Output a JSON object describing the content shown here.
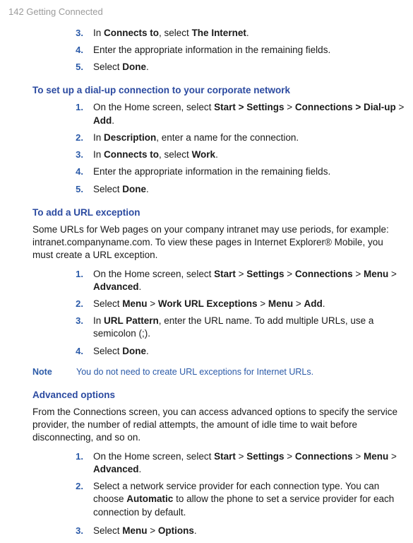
{
  "header": "142  Getting Connected",
  "topSteps": [
    {
      "num": "3.",
      "plain1": "In ",
      "bold1": "Connects to",
      "plain2": ", select ",
      "bold2": "The Internet",
      "plain3": "."
    },
    {
      "num": "4.",
      "plain1": "Enter the appropriate information in the remaining fields."
    },
    {
      "num": "5.",
      "plain1": "Select ",
      "bold1": "Done",
      "plain2": "."
    }
  ],
  "sec1": {
    "heading": "To set up a dial-up connection to your corporate network",
    "steps": [
      {
        "num": "1.",
        "plain1": "On the Home screen, select ",
        "bold1": "Start > ",
        "bold2": "Settings",
        "plain2": " > ",
        "bold3": "Connections > Dial-up",
        "plain3": " > ",
        "bold4": "Add",
        "plain4": "."
      },
      {
        "num": "2.",
        "plain1": "In ",
        "bold1": "Description",
        "plain2": ", enter a name for the connection."
      },
      {
        "num": "3.",
        "plain1": "In ",
        "bold1": "Connects to",
        "plain2": ", select ",
        "bold2": "Work",
        "plain3": "."
      },
      {
        "num": "4.",
        "plain1": "Enter the appropriate information in the remaining fields."
      },
      {
        "num": "5.",
        "plain1": "Select ",
        "bold1": "Done",
        "plain2": "."
      }
    ]
  },
  "sec2": {
    "heading": "To add a URL exception",
    "intro": "Some URLs for Web pages on your company intranet may use periods, for example: intranet.companyname.com. To view these pages in Internet Explorer® Mobile, you must create a URL exception.",
    "steps": [
      {
        "num": "1.",
        "plain1": "On the Home screen, select ",
        "bold1": "Start",
        "plain2": " > ",
        "bold2": "Settings",
        "plain3": " > ",
        "bold3": "Connections",
        "plain4": " > ",
        "bold4": "Menu",
        "plain5": " > ",
        "bold5": "Advanced",
        "plain6": "."
      },
      {
        "num": "2.",
        "plain1": "Select ",
        "bold1": "Menu",
        "plain2": " > ",
        "bold2": "Work URL Exceptions",
        "plain3": " > ",
        "bold3": "Menu",
        "plain4": " > ",
        "bold4": "Add",
        "plain5": "."
      },
      {
        "num": "3.",
        "plain1": "In ",
        "bold1": "URL Pattern",
        "plain2": ", enter the URL name. To add multiple URLs, use a semicolon (;)."
      },
      {
        "num": "4.",
        "plain1": "Select ",
        "bold1": "Done",
        "plain2": "."
      }
    ],
    "noteLabel": "Note",
    "noteBody": "You do not need to create URL exceptions for Internet URLs."
  },
  "sec3": {
    "heading": "Advanced options",
    "intro": "From the Connections screen, you can access advanced options to specify the service provider, the number of redial attempts, the amount of idle time to wait before disconnecting, and so on.",
    "steps": [
      {
        "num": "1.",
        "plain1": "On the Home screen, select ",
        "bold1": "Start",
        "plain2": " > ",
        "bold2": "Settings",
        "plain3": " > ",
        "bold3": "Connections",
        "plain4": " > ",
        "bold4": "Menu",
        "plain5": " > ",
        "bold5": "Advanced",
        "plain6": "."
      },
      {
        "num": "2.",
        "plain1": "Select a network service provider for each connection type. You can choose ",
        "bold1": "Automatic",
        "plain2": " to allow the phone to set a service provider for each connection by default."
      },
      {
        "num": "3.",
        "plain1": "Select ",
        "bold1": "Menu",
        "plain2": " > ",
        "bold2": "Options",
        "plain3": "."
      }
    ]
  }
}
